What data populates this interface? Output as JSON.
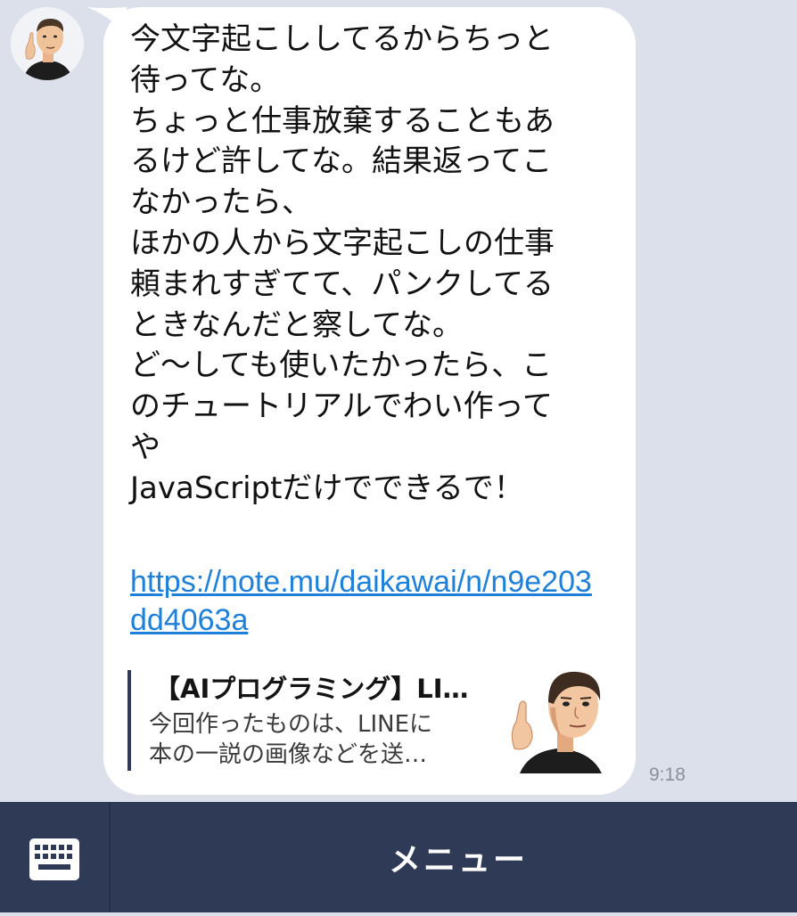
{
  "message": {
    "text": "今文字起こししてるからちっと\n待ってな。\nちょっと仕事放棄することもあ\nるけど許してな。結果返ってこ\nなかったら、\nほかの人から文字起こしの仕事\n頼まれすぎてて、パンクしてる\nときなんだと察してな。\nど〜しても使いたかったら、こ\nのチュートリアルでわい作って\nや\nJavaScriptだけでできるで！",
    "link": "https://note.mu/daikawai/n/n9e203dd4063a",
    "time": "9:18"
  },
  "preview": {
    "title": "【AIプログラミング】LINEで画像を送ると…",
    "description": "今回作ったものは、LINEに\n本の一説の画像などを送…",
    "thumbnail_icon": "person-pointing-illustration"
  },
  "sender": {
    "avatar_icon": "person-pointing-avatar"
  },
  "bottom_bar": {
    "menu_label": "メニュー",
    "keyboard_icon": "keyboard-icon"
  },
  "colors": {
    "chat_background": "#dbe0eb",
    "bubble": "#ffffff",
    "link": "#1f80d9",
    "bottom_bar": "#2f3b56"
  }
}
